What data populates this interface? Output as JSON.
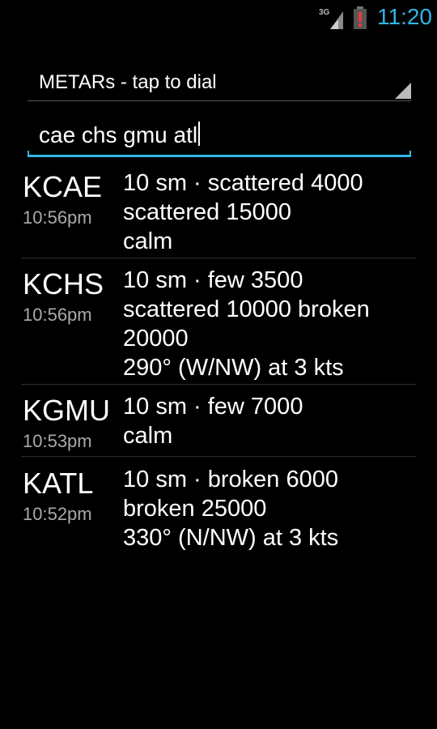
{
  "status_bar": {
    "network_label": "3G",
    "signal_icon": "signal-icon",
    "battery_icon": "battery-alert-icon",
    "time": "11:20",
    "accent_color": "#33b5e5"
  },
  "spinner": {
    "label": "METARs - tap to dial"
  },
  "query": {
    "value": "cae chs gmu atl"
  },
  "reports": [
    {
      "station": "KCAE",
      "time": "10:56pm",
      "lines": [
        "10 sm · scattered 4000",
        "scattered 15000",
        "calm"
      ]
    },
    {
      "station": "KCHS",
      "time": "10:56pm",
      "lines": [
        "10 sm · few 3500",
        "scattered 10000 broken",
        "20000",
        "290° (W/NW) at 3 kts"
      ]
    },
    {
      "station": "KGMU",
      "time": "10:53pm",
      "lines": [
        "10 sm · few 7000",
        "calm"
      ]
    },
    {
      "station": "KATL",
      "time": "10:52pm",
      "lines": [
        "10 sm · broken 6000",
        "broken 25000",
        "330° (N/NW) at 3 kts"
      ]
    }
  ]
}
